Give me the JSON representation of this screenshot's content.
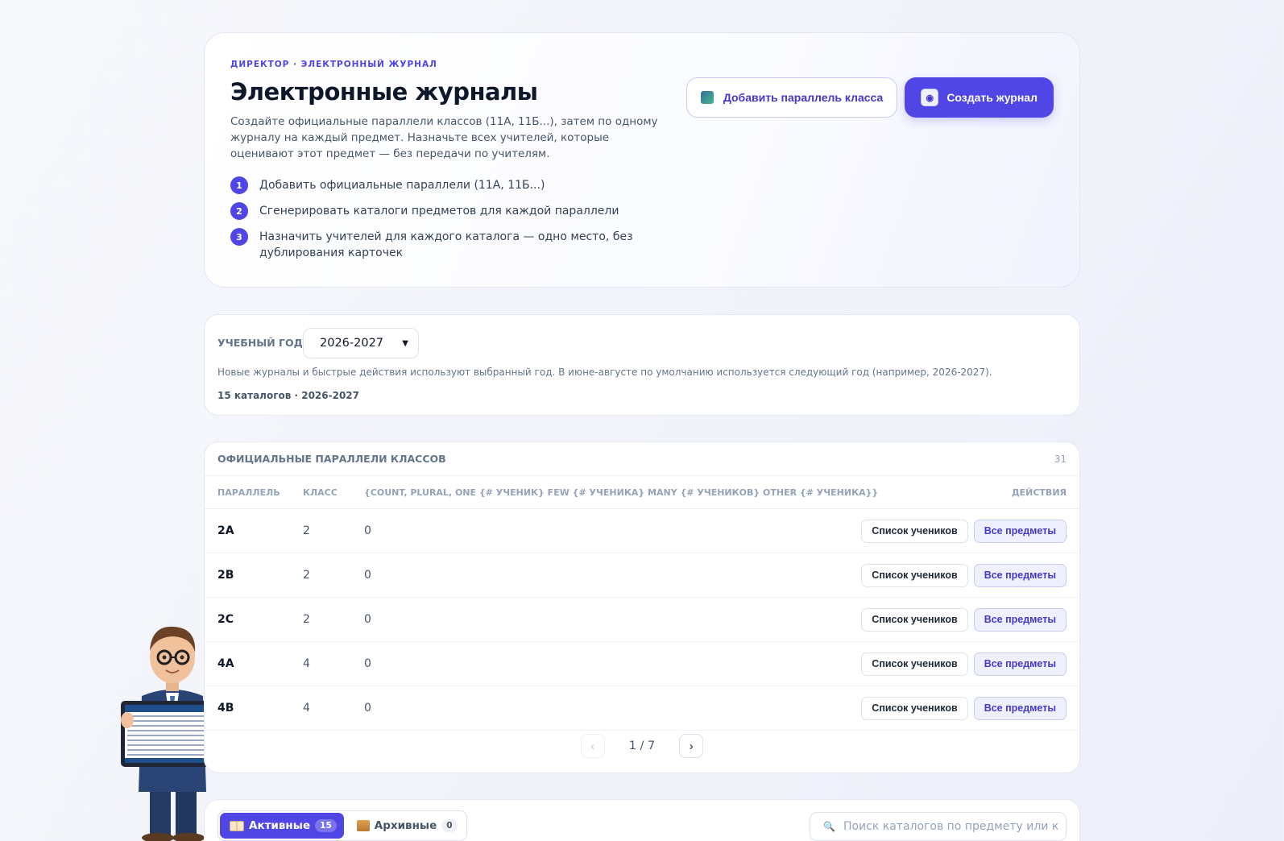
{
  "hero": {
    "eyebrow": "ДИРЕКТОР · ЭЛЕКТРОННЫЙ ЖУРНАЛ",
    "title": "Электронные журналы",
    "description": "Создайте официальные параллели классов (11А, 11Б...), затем по одному журналу на каждый предмет. Назначьте всех учителей, которые оценивают этот предмет — без передачи по учителям.",
    "steps": [
      {
        "num": "1",
        "text": "Добавить официальные параллели (11А, 11Б...)"
      },
      {
        "num": "2",
        "text": "Сгенерировать каталоги предметов для каждой параллели"
      },
      {
        "num": "3",
        "text": "Назначить учителей для каждого каталога — одно место, без дублирования карточек"
      }
    ],
    "add_parallel_label": "Добавить параллель класса",
    "create_journal_label": "Создать журнал"
  },
  "year": {
    "label": "УЧЕБНЫЙ ГОД",
    "selected": "2026-2027",
    "note": "Новые журналы и быстрые действия используют выбранный год. В июне-августе по умолчанию используется следующий год (например, 2026-2027).",
    "count": "15 каталогов · 2026-2027"
  },
  "parallels": {
    "title": "ОФИЦИАЛЬНЫЕ ПАРАЛЛЕЛИ КЛАССОВ",
    "total": "31",
    "columns": {
      "parallel": "ПАРАЛЛЕЛЬ",
      "grade": "КЛАСС",
      "students": "{COUNT, PLURAL, ONE {# УЧЕНИК} FEW {# УЧЕНИКА} MANY {# УЧЕНИКОВ} OTHER {# УЧЕНИКА}}",
      "actions": "ДЕЙСТВИЯ"
    },
    "rows": [
      {
        "parallel": "2A",
        "grade": "2",
        "students": "0"
      },
      {
        "parallel": "2B",
        "grade": "2",
        "students": "0"
      },
      {
        "parallel": "2C",
        "grade": "2",
        "students": "0"
      },
      {
        "parallel": "4A",
        "grade": "4",
        "students": "0"
      },
      {
        "parallel": "4B",
        "grade": "4",
        "students": "0"
      }
    ],
    "btn_students": "Список учеников",
    "btn_subjects": "Все предметы",
    "pager": {
      "label": "1 / 7",
      "prev": "‹",
      "next": "›"
    }
  },
  "catalogs": {
    "active_label": "Активные",
    "active_count": "15",
    "archived_label": "Архивные",
    "archived_count": "0",
    "search_placeholder": "Поиск каталогов по предмету или клас"
  }
}
